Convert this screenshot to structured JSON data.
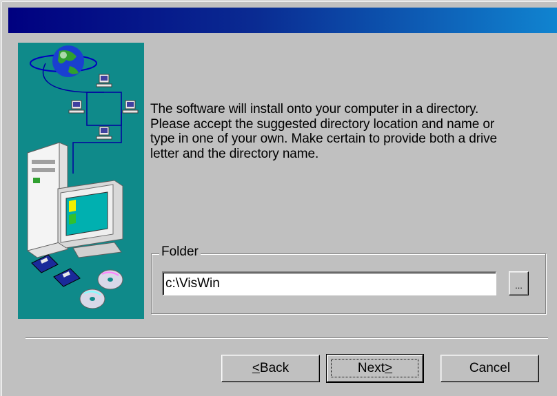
{
  "dialog": {
    "description": "The software will install onto your computer in a directory.\nPlease accept the suggested directory location and name or\ntype in one of your own.  Make certain to provide both a drive\nletter and the directory name."
  },
  "folder": {
    "group_label": "Folder",
    "path_value": "c:\\VisWin",
    "browse_label": "..."
  },
  "buttons": {
    "back": {
      "accel": "<",
      "rest": "Back"
    },
    "next": {
      "pre": "Next",
      "accel": ">"
    },
    "cancel": "Cancel"
  },
  "colors": {
    "face": "#c0c0c0",
    "titlebar_start": "#000080",
    "titlebar_end": "#1084d0",
    "art_background": "#0f8a8a"
  },
  "icons": [
    "globe-icon",
    "network-computer-icon",
    "desktop-computer-icon",
    "floppy-disk-icon",
    "cd-disc-icon"
  ]
}
